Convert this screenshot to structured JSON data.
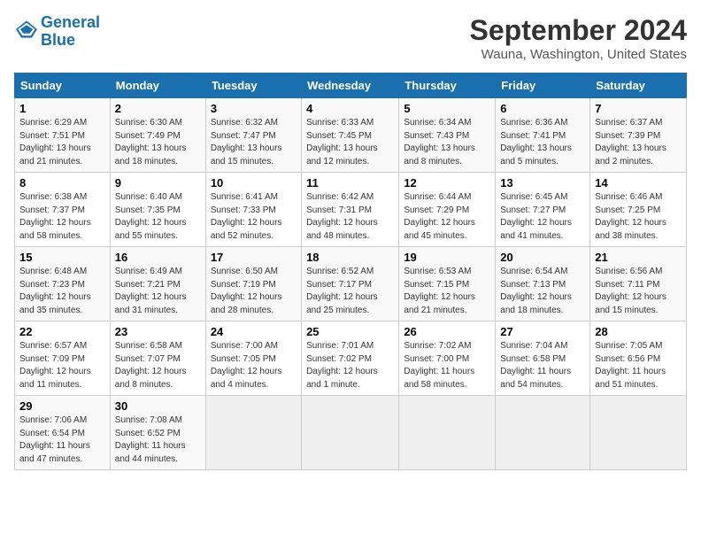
{
  "header": {
    "logo_line1": "General",
    "logo_line2": "Blue",
    "title": "September 2024",
    "subtitle": "Wauna, Washington, United States"
  },
  "days_of_week": [
    "Sunday",
    "Monday",
    "Tuesday",
    "Wednesday",
    "Thursday",
    "Friday",
    "Saturday"
  ],
  "weeks": [
    [
      {
        "day": "1",
        "info": "Sunrise: 6:29 AM\nSunset: 7:51 PM\nDaylight: 13 hours and 21 minutes."
      },
      {
        "day": "2",
        "info": "Sunrise: 6:30 AM\nSunset: 7:49 PM\nDaylight: 13 hours and 18 minutes."
      },
      {
        "day": "3",
        "info": "Sunrise: 6:32 AM\nSunset: 7:47 PM\nDaylight: 13 hours and 15 minutes."
      },
      {
        "day": "4",
        "info": "Sunrise: 6:33 AM\nSunset: 7:45 PM\nDaylight: 13 hours and 12 minutes."
      },
      {
        "day": "5",
        "info": "Sunrise: 6:34 AM\nSunset: 7:43 PM\nDaylight: 13 hours and 8 minutes."
      },
      {
        "day": "6",
        "info": "Sunrise: 6:36 AM\nSunset: 7:41 PM\nDaylight: 13 hours and 5 minutes."
      },
      {
        "day": "7",
        "info": "Sunrise: 6:37 AM\nSunset: 7:39 PM\nDaylight: 13 hours and 2 minutes."
      }
    ],
    [
      {
        "day": "8",
        "info": "Sunrise: 6:38 AM\nSunset: 7:37 PM\nDaylight: 12 hours and 58 minutes."
      },
      {
        "day": "9",
        "info": "Sunrise: 6:40 AM\nSunset: 7:35 PM\nDaylight: 12 hours and 55 minutes."
      },
      {
        "day": "10",
        "info": "Sunrise: 6:41 AM\nSunset: 7:33 PM\nDaylight: 12 hours and 52 minutes."
      },
      {
        "day": "11",
        "info": "Sunrise: 6:42 AM\nSunset: 7:31 PM\nDaylight: 12 hours and 48 minutes."
      },
      {
        "day": "12",
        "info": "Sunrise: 6:44 AM\nSunset: 7:29 PM\nDaylight: 12 hours and 45 minutes."
      },
      {
        "day": "13",
        "info": "Sunrise: 6:45 AM\nSunset: 7:27 PM\nDaylight: 12 hours and 41 minutes."
      },
      {
        "day": "14",
        "info": "Sunrise: 6:46 AM\nSunset: 7:25 PM\nDaylight: 12 hours and 38 minutes."
      }
    ],
    [
      {
        "day": "15",
        "info": "Sunrise: 6:48 AM\nSunset: 7:23 PM\nDaylight: 12 hours and 35 minutes."
      },
      {
        "day": "16",
        "info": "Sunrise: 6:49 AM\nSunset: 7:21 PM\nDaylight: 12 hours and 31 minutes."
      },
      {
        "day": "17",
        "info": "Sunrise: 6:50 AM\nSunset: 7:19 PM\nDaylight: 12 hours and 28 minutes."
      },
      {
        "day": "18",
        "info": "Sunrise: 6:52 AM\nSunset: 7:17 PM\nDaylight: 12 hours and 25 minutes."
      },
      {
        "day": "19",
        "info": "Sunrise: 6:53 AM\nSunset: 7:15 PM\nDaylight: 12 hours and 21 minutes."
      },
      {
        "day": "20",
        "info": "Sunrise: 6:54 AM\nSunset: 7:13 PM\nDaylight: 12 hours and 18 minutes."
      },
      {
        "day": "21",
        "info": "Sunrise: 6:56 AM\nSunset: 7:11 PM\nDaylight: 12 hours and 15 minutes."
      }
    ],
    [
      {
        "day": "22",
        "info": "Sunrise: 6:57 AM\nSunset: 7:09 PM\nDaylight: 12 hours and 11 minutes."
      },
      {
        "day": "23",
        "info": "Sunrise: 6:58 AM\nSunset: 7:07 PM\nDaylight: 12 hours and 8 minutes."
      },
      {
        "day": "24",
        "info": "Sunrise: 7:00 AM\nSunset: 7:05 PM\nDaylight: 12 hours and 4 minutes."
      },
      {
        "day": "25",
        "info": "Sunrise: 7:01 AM\nSunset: 7:02 PM\nDaylight: 12 hours and 1 minute."
      },
      {
        "day": "26",
        "info": "Sunrise: 7:02 AM\nSunset: 7:00 PM\nDaylight: 11 hours and 58 minutes."
      },
      {
        "day": "27",
        "info": "Sunrise: 7:04 AM\nSunset: 6:58 PM\nDaylight: 11 hours and 54 minutes."
      },
      {
        "day": "28",
        "info": "Sunrise: 7:05 AM\nSunset: 6:56 PM\nDaylight: 11 hours and 51 minutes."
      }
    ],
    [
      {
        "day": "29",
        "info": "Sunrise: 7:06 AM\nSunset: 6:54 PM\nDaylight: 11 hours and 47 minutes."
      },
      {
        "day": "30",
        "info": "Sunrise: 7:08 AM\nSunset: 6:52 PM\nDaylight: 11 hours and 44 minutes."
      },
      {
        "day": "",
        "info": ""
      },
      {
        "day": "",
        "info": ""
      },
      {
        "day": "",
        "info": ""
      },
      {
        "day": "",
        "info": ""
      },
      {
        "day": "",
        "info": ""
      }
    ]
  ]
}
